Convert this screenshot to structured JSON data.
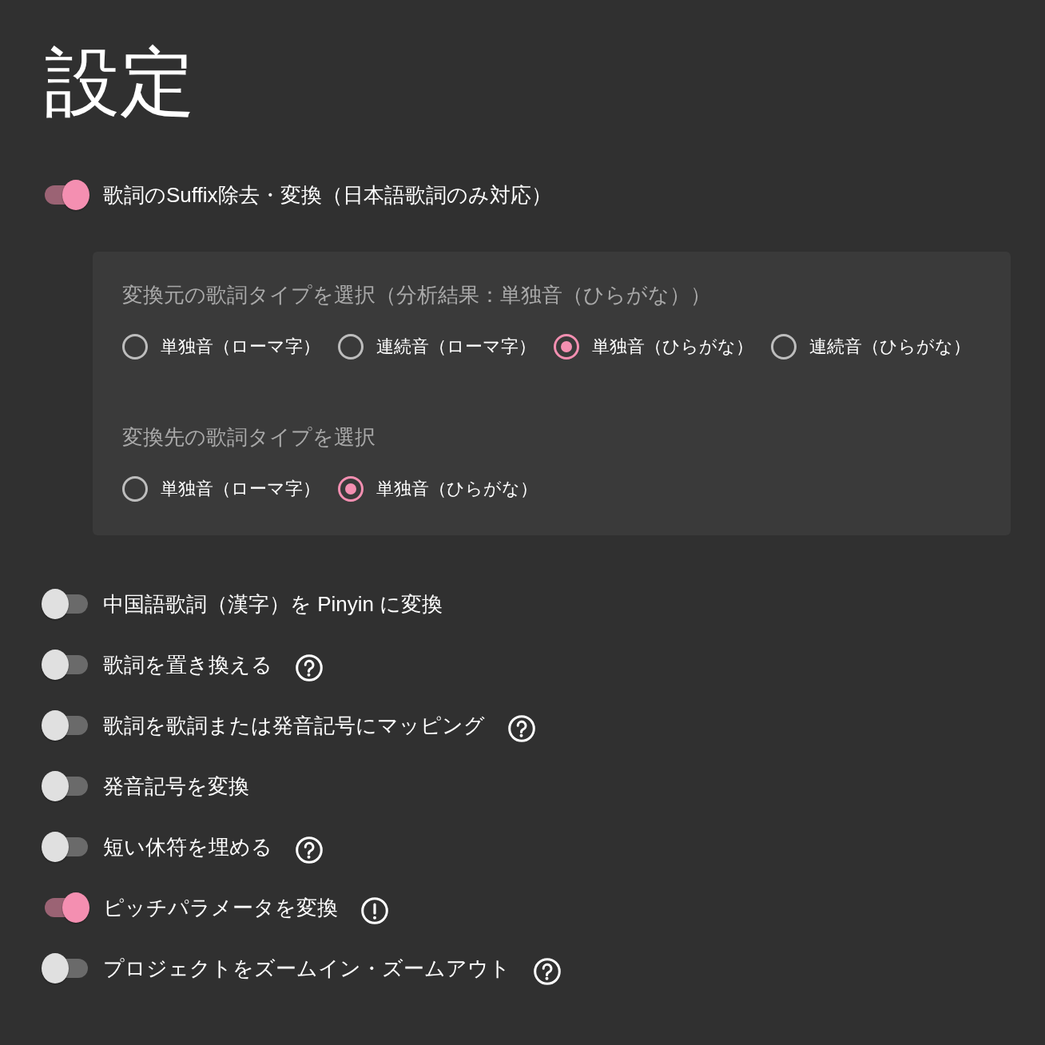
{
  "page": {
    "title": "設定"
  },
  "settings": [
    {
      "kind": "plain",
      "label": "歌詞のSuffix除去・変換（日本語歌詞のみ対応）",
      "on": true,
      "panel": {
        "groups": [
          {
            "label": "変換元の歌詞タイプを選択（分析結果：単独音（ひらがな））",
            "options": [
              {
                "label": "単独音（ローマ字）",
                "selected": false
              },
              {
                "label": "連続音（ローマ字）",
                "selected": false
              },
              {
                "label": "単独音（ひらがな）",
                "selected": true
              },
              {
                "label": "連続音（ひらがな）",
                "selected": false
              }
            ]
          },
          {
            "label": "変換先の歌詞タイプを選択",
            "options": [
              {
                "label": "単独音（ローマ字）",
                "selected": false
              },
              {
                "label": "単独音（ひらがな）",
                "selected": true
              }
            ]
          }
        ]
      }
    },
    {
      "kind": "plain",
      "label": "中国語歌詞（漢字）を Pinyin に変換",
      "on": false
    },
    {
      "kind": "help",
      "label": "歌詞を置き換える",
      "on": false
    },
    {
      "kind": "help",
      "label": "歌詞を歌詞または発音記号にマッピング",
      "on": false
    },
    {
      "kind": "plain",
      "label": "発音記号を変換",
      "on": false
    },
    {
      "kind": "help",
      "label": "短い休符を埋める",
      "on": false
    },
    {
      "kind": "warning",
      "label": "ピッチパラメータを変換",
      "on": true
    },
    {
      "kind": "help",
      "label": "プロジェクトをズームイン・ズームアウト",
      "on": false
    }
  ]
}
